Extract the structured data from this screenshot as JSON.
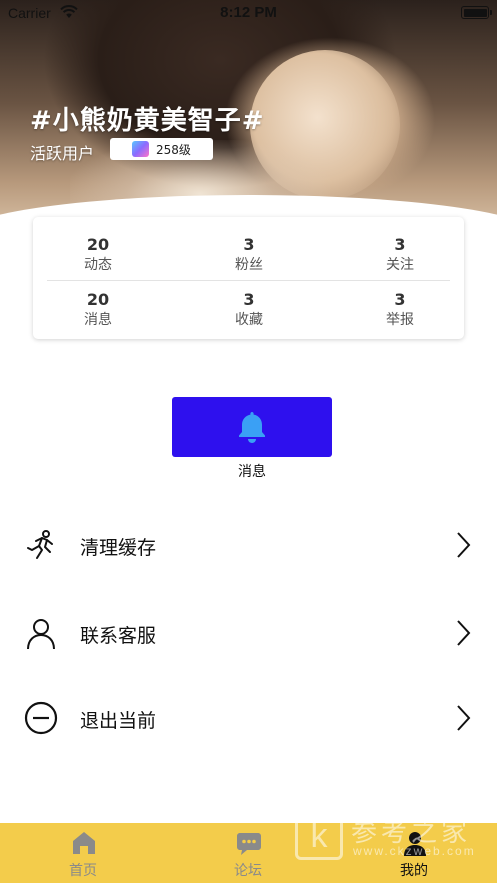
{
  "status_bar": {
    "carrier": "Carrier",
    "time": "8:12 PM"
  },
  "profile": {
    "name": "#小熊奶黄美智子#",
    "subtitle": "活跃用户",
    "level": "258级"
  },
  "stats": [
    {
      "value": "20",
      "label": "动态"
    },
    {
      "value": "3",
      "label": "粉丝"
    },
    {
      "value": "3",
      "label": "关注"
    },
    {
      "value": "20",
      "label": "消息"
    },
    {
      "value": "3",
      "label": "收藏"
    },
    {
      "value": "3",
      "label": "举报"
    }
  ],
  "message_button": {
    "label": "消息",
    "icon": "bell-icon",
    "bg_color": "#2e10ee",
    "icon_color": "#3aa0f5"
  },
  "menu": [
    {
      "label": "清理缓存",
      "icon": "running-person-icon"
    },
    {
      "label": "联系客服",
      "icon": "person-outline-icon"
    },
    {
      "label": "退出当前",
      "icon": "minus-circle-icon"
    }
  ],
  "tab_bar": {
    "bg_color": "#f3cc4b",
    "tabs": [
      {
        "label": "首页",
        "icon": "home-icon",
        "active": false
      },
      {
        "label": "论坛",
        "icon": "chat-icon",
        "active": false
      },
      {
        "label": "我的",
        "icon": "user-icon",
        "active": true
      }
    ]
  },
  "watermark": {
    "text": "参考之家",
    "url": "www.ckzweb.com"
  }
}
